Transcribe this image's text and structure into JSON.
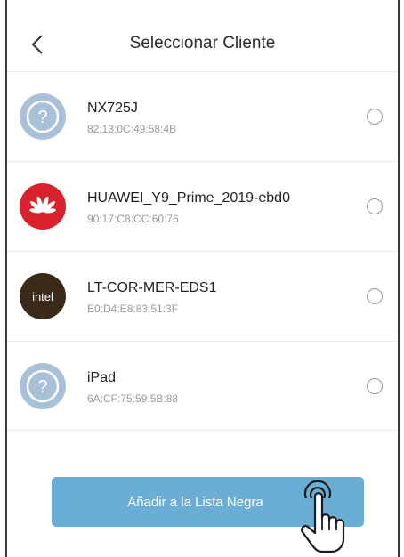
{
  "header": {
    "title": "Seleccionar Cliente",
    "back_icon": "chevron-left-icon"
  },
  "clients": [
    {
      "name": "NX725J",
      "mac": "82:13:0C:49:58:4B",
      "icon": "unknown-device-icon",
      "selected": false
    },
    {
      "name": "HUAWEI_Y9_Prime_2019-ebd0",
      "mac": "90:17:C8:CC:60:76",
      "icon": "huawei-logo-icon",
      "selected": false
    },
    {
      "name": "LT-COR-MER-EDS1",
      "mac": "E0:D4:E8:83:51:3F",
      "icon": "intel-logo-icon",
      "icon_text": "intel",
      "selected": false
    },
    {
      "name": "iPad",
      "mac": "6A:CF:75:59:5B:88",
      "icon": "unknown-device-icon",
      "selected": false
    }
  ],
  "footer": {
    "add_button_label": "Añadir a la Lista Negra",
    "cursor_icon": "hand-pointer-icon"
  },
  "colors": {
    "accent": "#6aaed6",
    "unknown_avatar": "#a9c0d9",
    "huawei_red": "#d8232f",
    "intel_dark": "#3a2a1a"
  }
}
